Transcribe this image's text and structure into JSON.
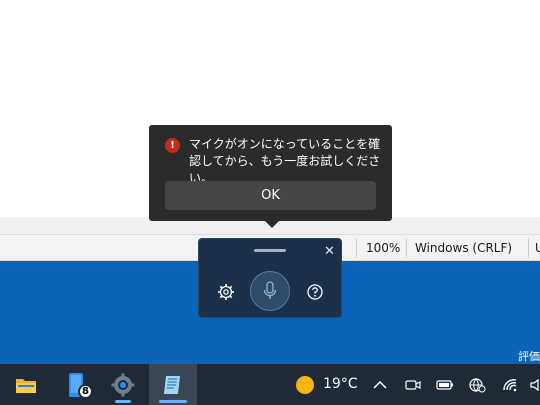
{
  "statusbar": {
    "zoom": "100%",
    "line_ending": "Windows (CRLF)",
    "encoding_partial": "U"
  },
  "flyout": {
    "message": "マイクがオンになっていることを確認してから、もう一度お試しください。",
    "ok_label": "OK",
    "error_icon": "!"
  },
  "voice_panel": {
    "close_label": "✕"
  },
  "desktop": {
    "corner_text": "評価"
  },
  "taskbar": {
    "phone_badge": "8",
    "weather_temp": "19°C"
  }
}
